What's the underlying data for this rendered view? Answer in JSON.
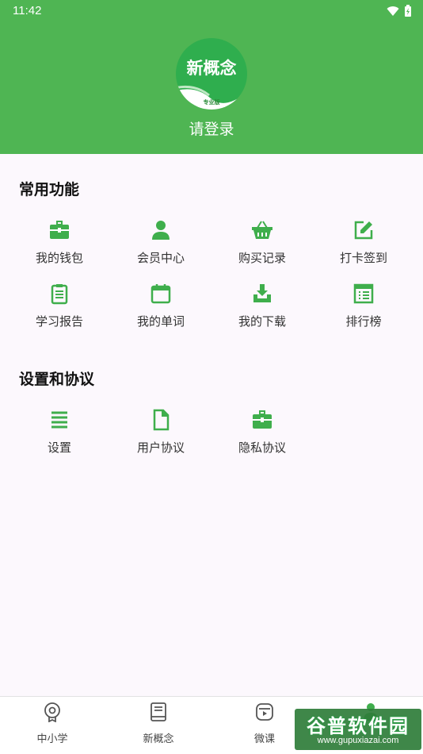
{
  "status": {
    "time": "11:42"
  },
  "profile": {
    "logo_text": "新概念",
    "logo_badge": "专业版",
    "login_label": "请登录"
  },
  "sections": {
    "common": {
      "title": "常用功能",
      "items": [
        {
          "label": "我的钱包",
          "icon": "wallet-icon"
        },
        {
          "label": "会员中心",
          "icon": "person-icon"
        },
        {
          "label": "购买记录",
          "icon": "basket-icon"
        },
        {
          "label": "打卡签到",
          "icon": "edit-icon"
        },
        {
          "label": "学习报告",
          "icon": "clipboard-icon"
        },
        {
          "label": "我的单词",
          "icon": "calendar-icon"
        },
        {
          "label": "我的下载",
          "icon": "download-icon"
        },
        {
          "label": "排行榜",
          "icon": "list-board-icon"
        }
      ]
    },
    "settings": {
      "title": "设置和协议",
      "items": [
        {
          "label": "设置",
          "icon": "menu-lines-icon"
        },
        {
          "label": "用户协议",
          "icon": "document-icon"
        },
        {
          "label": "隐私协议",
          "icon": "briefcase-icon"
        }
      ]
    }
  },
  "bottom_nav": [
    {
      "label": "中小学",
      "icon": "medal-icon"
    },
    {
      "label": "新概念",
      "icon": "book-icon"
    },
    {
      "label": "微课",
      "icon": "video-icon"
    },
    {
      "label": "",
      "icon": "profile-icon",
      "active": true
    }
  ],
  "watermark": {
    "title": "谷普软件园",
    "url": "www.gupuxiazai.com"
  },
  "colors": {
    "primary": "#4fb553",
    "icon_green": "#3fae4c",
    "background": "#fcf8fd"
  }
}
